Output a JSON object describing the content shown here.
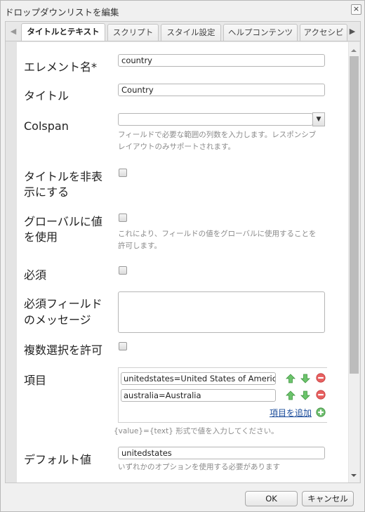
{
  "dialog": {
    "title": "ドロップダウンリストを編集",
    "close_icon": "×"
  },
  "tabs": {
    "scroll_left_icon": "🡐",
    "scroll_right_icon": "🡒",
    "items": [
      {
        "label": "タイトルとテキスト",
        "active": true
      },
      {
        "label": "スクリプト",
        "active": false
      },
      {
        "label": "スタイル設定",
        "active": false
      },
      {
        "label": "ヘルプコンテンツ",
        "active": false
      },
      {
        "label": "アクセシビ",
        "active": false
      }
    ]
  },
  "form": {
    "element_name": {
      "label": "エレメント名*",
      "value": "country"
    },
    "title": {
      "label": "タイトル",
      "value": "Country"
    },
    "colspan": {
      "label": "Colspan",
      "value": "",
      "help_line1": "フィールドで必要な範囲の列数を入力します。レスポンシブ",
      "help_line2": "レイアウトのみサポートされます。"
    },
    "hide_title": {
      "label_line1": "タイトルを非表",
      "label_line2": "示にする",
      "checked": false
    },
    "use_global": {
      "label_line1": "グローバルに値",
      "label_line2": "を使用",
      "checked": false,
      "help_line1": "これにより、フィールドの値をグローバルに使用することを",
      "help_line2": "許可します。"
    },
    "required": {
      "label": "必須",
      "checked": false
    },
    "required_message": {
      "label_line1": "必須フィールド",
      "label_line2": "のメッセージ",
      "value": ""
    },
    "allow_multiple": {
      "label": "複数選択を許可",
      "checked": false
    },
    "items": {
      "label": "項目",
      "entries": [
        {
          "value": "unitedstates=United States of America"
        },
        {
          "value": "australia=Australia"
        }
      ],
      "add_label": "項目を追加",
      "help": "{value}={text} 形式で値を入力してください。"
    },
    "default_value": {
      "label": "デフォルト値",
      "value": "unitedstates",
      "help": "いずれかのオプションを使用する必要があります"
    }
  },
  "footer": {
    "ok_label": "OK",
    "cancel_label": "キャンセル"
  },
  "scroll": {
    "position_fraction": 0.0,
    "visible_fraction": 0.73
  },
  "colors": {
    "move_up": "#5cb85c",
    "move_down": "#5cb85c",
    "remove": "#e05555",
    "add": "#5fb35f",
    "link": "#1a4b9a"
  }
}
